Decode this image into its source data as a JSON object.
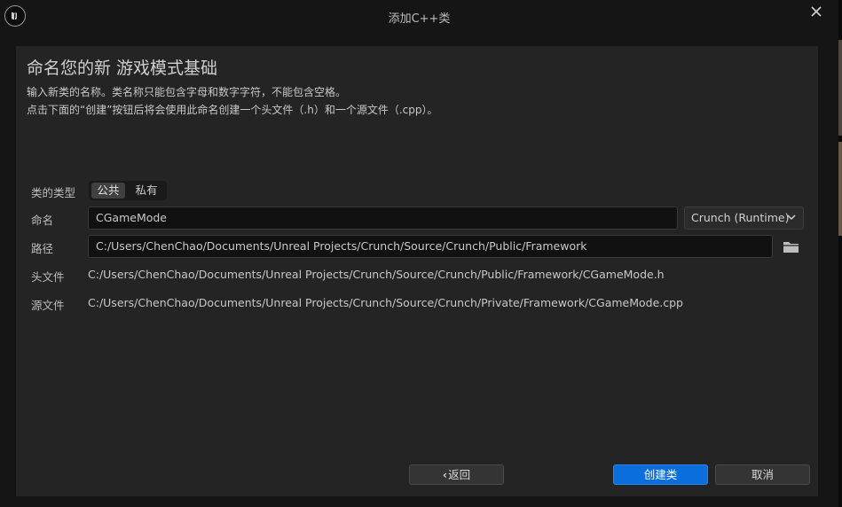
{
  "window": {
    "title": "添加C++类"
  },
  "header": {
    "heading": "命名您的新 游戏模式基础",
    "description_line1": "输入新类的名称。类名称只能包含字母和数字字符，不能包含空格。",
    "description_line2": "点击下面的“创建”按钮后将会使用此命名创建一个头文件（.h）和一个源文件（.cpp）。"
  },
  "form": {
    "class_type": {
      "label": "类的类型",
      "options": [
        "公共",
        "私有"
      ],
      "selected": "公共"
    },
    "name": {
      "label": "命名",
      "value": "CGameMode"
    },
    "module": {
      "selected": "Crunch (Runtime)"
    },
    "path": {
      "label": "路径",
      "value": "C:/Users/ChenChao/Documents/Unreal Projects/Crunch/Source/Crunch/Public/Framework"
    },
    "header_file": {
      "label": "头文件",
      "value": "C:/Users/ChenChao/Documents/Unreal Projects/Crunch/Source/Crunch/Public/Framework/CGameMode.h"
    },
    "source_file": {
      "label": "源文件",
      "value": "C:/Users/ChenChao/Documents/Unreal Projects/Crunch/Source/Crunch/Private/Framework/CGameMode.cpp"
    }
  },
  "footer": {
    "back_label": "返回",
    "create_label": "创建类",
    "cancel_label": "取消"
  },
  "colors": {
    "background": "#151515",
    "panel": "#242424",
    "accent": "#0a6fdc"
  },
  "icons": [
    "unreal-logo-icon",
    "close-icon",
    "chevron-down-icon",
    "folder-icon",
    "chevron-left-icon"
  ]
}
